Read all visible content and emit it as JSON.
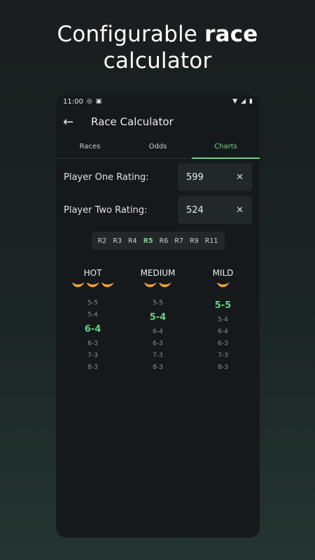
{
  "headline": {
    "line1": "Configurable",
    "line1_bold": "race",
    "line2": "calculator"
  },
  "status_bar": {
    "time": "11:00"
  },
  "app_bar": {
    "title": "Race Calculator"
  },
  "tabs": [
    {
      "label": "Races",
      "active": false
    },
    {
      "label": "Odds",
      "active": false
    },
    {
      "label": "Charts",
      "active": true
    }
  ],
  "player_one": {
    "label": "Player One Rating:",
    "value": "599"
  },
  "player_two": {
    "label": "Player Two Rating:",
    "value": "524"
  },
  "rounds": [
    "R2",
    "R3",
    "R4",
    "R5",
    "R6",
    "R7",
    "R9",
    "R11"
  ],
  "selected_round": "R5",
  "columns": [
    {
      "name": "HOT",
      "peppers": 3,
      "scores": [
        "5-5",
        "5-4",
        "6-4",
        "6-3",
        "7-3",
        "8-3"
      ],
      "highlight": "6-4"
    },
    {
      "name": "MEDIUM",
      "peppers": 2,
      "scores": [
        "5-5",
        "5-4",
        "6-4",
        "6-3",
        "7-3",
        "8-3"
      ],
      "highlight": "5-4"
    },
    {
      "name": "MILD",
      "peppers": 1,
      "scores": [
        "5-5",
        "5-4",
        "6-4",
        "6-3",
        "7-3",
        "8-3"
      ],
      "highlight": "5-5"
    }
  ],
  "colors": {
    "accent": "#6fd38f",
    "pepper": "#f0a032",
    "background": "#16191c"
  }
}
